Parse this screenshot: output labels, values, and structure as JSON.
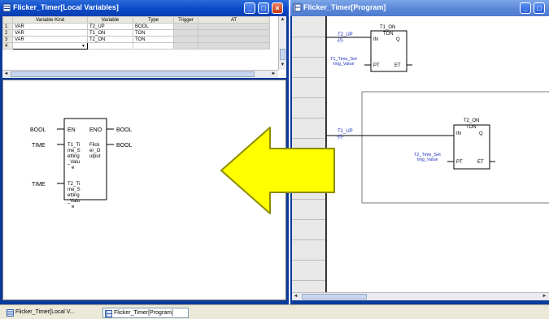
{
  "left_window": {
    "title": "Flicker_Timer[Local Variables]",
    "table": {
      "headers": [
        "Variable Kind",
        "Variable",
        "Type",
        "Trigger",
        "AT"
      ],
      "rows": [
        {
          "num": "1",
          "kind": "VAR",
          "variable": "T2_UP",
          "type": "BOOL"
        },
        {
          "num": "2",
          "kind": "VAR",
          "variable": "T1_ON",
          "type": "TON"
        },
        {
          "num": "3",
          "kind": "VAR",
          "variable": "T2_ON",
          "type": "TON"
        },
        {
          "num": "4",
          "kind": "",
          "variable": "",
          "type": ""
        }
      ]
    },
    "fbd": {
      "en": "EN",
      "eno": "ENO",
      "left_types": [
        "BOOL",
        "TIME",
        "TIME"
      ],
      "right_types": [
        "BOOL",
        "BOOL"
      ],
      "input1_lines": [
        "T1_Ti",
        "me_S",
        "etting",
        "_Valu",
        "e"
      ],
      "output_lines": [
        "Flick",
        "er_O",
        "utput"
      ],
      "input2_lines": [
        "T2_Ti",
        "me_S",
        "etting",
        "_Valu",
        "e"
      ]
    }
  },
  "right_window": {
    "title": "Flicker_Timer[Program]",
    "rung1": {
      "contact_label": "T2_UP",
      "contact_symbol": "-|/|-",
      "timer_instance": "T1_ON",
      "timer_type": "TON",
      "pin_in": "IN",
      "pin_q": "Q",
      "pin_pt": "PT",
      "pin_et": "ET",
      "preset_lines": [
        "T1_Time_Set",
        "ting_Value"
      ]
    },
    "rung2": {
      "contact_label": "T1_UP",
      "contact_symbol": "-|/|-",
      "timer_instance": "T2_ON",
      "timer_type": "TON",
      "pin_in": "IN",
      "pin_q": "Q",
      "pin_pt": "PT",
      "pin_et": "ET",
      "preset_lines": [
        "T2_Time_Set",
        "ting_Value"
      ]
    }
  },
  "taskbar": {
    "tabs": [
      "Flicker_Timer[Local V...",
      "Flicker_Timer[Program]"
    ]
  },
  "colors": {
    "arrow_fill": "#ffff00",
    "arrow_stroke": "#8c8c00",
    "label_blue": "#1a2fc0",
    "titlebar_active": "#0b49c7",
    "titlebar_inactive": "#5a87d8"
  }
}
